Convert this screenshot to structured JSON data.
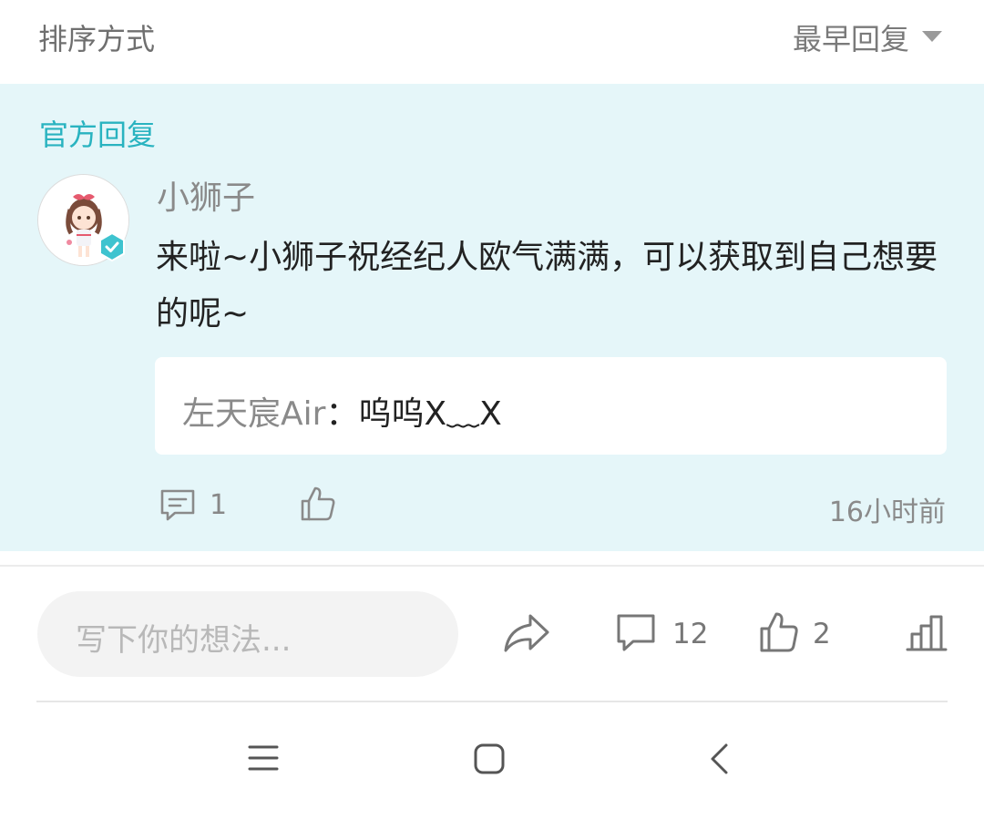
{
  "sort": {
    "label": "排序方式",
    "value": "最早回复"
  },
  "official_reply": {
    "title": "官方回复",
    "author": "小狮子",
    "content": "来啦~小狮子祝经纪人欧气满满，可以获取到自己想要的呢~",
    "quote": {
      "user": "左天宸Air",
      "separator": "：",
      "text": "呜呜X﹏X"
    },
    "comment_count": "1",
    "time": "16小时前"
  },
  "action_bar": {
    "input_placeholder": "写下你的想法...",
    "comment_count": "12",
    "like_count": "2"
  },
  "colors": {
    "accent": "#29b3c0",
    "highlight_bg": "#e5f6f9"
  },
  "icons": [
    "chevron-down-icon",
    "verified-badge-icon",
    "comment-icon",
    "thumbs-up-icon",
    "share-icon",
    "stats-icon",
    "menu-icon",
    "home-icon",
    "back-icon"
  ]
}
